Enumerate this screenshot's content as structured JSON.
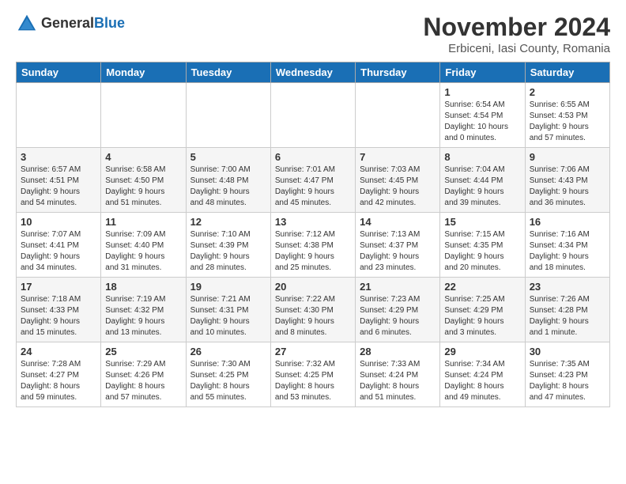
{
  "logo": {
    "general": "General",
    "blue": "Blue"
  },
  "title": "November 2024",
  "subtitle": "Erbiceni, Iasi County, Romania",
  "days_of_week": [
    "Sunday",
    "Monday",
    "Tuesday",
    "Wednesday",
    "Thursday",
    "Friday",
    "Saturday"
  ],
  "weeks": [
    [
      {
        "day": "",
        "info": ""
      },
      {
        "day": "",
        "info": ""
      },
      {
        "day": "",
        "info": ""
      },
      {
        "day": "",
        "info": ""
      },
      {
        "day": "",
        "info": ""
      },
      {
        "day": "1",
        "info": "Sunrise: 6:54 AM\nSunset: 4:54 PM\nDaylight: 10 hours\nand 0 minutes."
      },
      {
        "day": "2",
        "info": "Sunrise: 6:55 AM\nSunset: 4:53 PM\nDaylight: 9 hours\nand 57 minutes."
      }
    ],
    [
      {
        "day": "3",
        "info": "Sunrise: 6:57 AM\nSunset: 4:51 PM\nDaylight: 9 hours\nand 54 minutes."
      },
      {
        "day": "4",
        "info": "Sunrise: 6:58 AM\nSunset: 4:50 PM\nDaylight: 9 hours\nand 51 minutes."
      },
      {
        "day": "5",
        "info": "Sunrise: 7:00 AM\nSunset: 4:48 PM\nDaylight: 9 hours\nand 48 minutes."
      },
      {
        "day": "6",
        "info": "Sunrise: 7:01 AM\nSunset: 4:47 PM\nDaylight: 9 hours\nand 45 minutes."
      },
      {
        "day": "7",
        "info": "Sunrise: 7:03 AM\nSunset: 4:45 PM\nDaylight: 9 hours\nand 42 minutes."
      },
      {
        "day": "8",
        "info": "Sunrise: 7:04 AM\nSunset: 4:44 PM\nDaylight: 9 hours\nand 39 minutes."
      },
      {
        "day": "9",
        "info": "Sunrise: 7:06 AM\nSunset: 4:43 PM\nDaylight: 9 hours\nand 36 minutes."
      }
    ],
    [
      {
        "day": "10",
        "info": "Sunrise: 7:07 AM\nSunset: 4:41 PM\nDaylight: 9 hours\nand 34 minutes."
      },
      {
        "day": "11",
        "info": "Sunrise: 7:09 AM\nSunset: 4:40 PM\nDaylight: 9 hours\nand 31 minutes."
      },
      {
        "day": "12",
        "info": "Sunrise: 7:10 AM\nSunset: 4:39 PM\nDaylight: 9 hours\nand 28 minutes."
      },
      {
        "day": "13",
        "info": "Sunrise: 7:12 AM\nSunset: 4:38 PM\nDaylight: 9 hours\nand 25 minutes."
      },
      {
        "day": "14",
        "info": "Sunrise: 7:13 AM\nSunset: 4:37 PM\nDaylight: 9 hours\nand 23 minutes."
      },
      {
        "day": "15",
        "info": "Sunrise: 7:15 AM\nSunset: 4:35 PM\nDaylight: 9 hours\nand 20 minutes."
      },
      {
        "day": "16",
        "info": "Sunrise: 7:16 AM\nSunset: 4:34 PM\nDaylight: 9 hours\nand 18 minutes."
      }
    ],
    [
      {
        "day": "17",
        "info": "Sunrise: 7:18 AM\nSunset: 4:33 PM\nDaylight: 9 hours\nand 15 minutes."
      },
      {
        "day": "18",
        "info": "Sunrise: 7:19 AM\nSunset: 4:32 PM\nDaylight: 9 hours\nand 13 minutes."
      },
      {
        "day": "19",
        "info": "Sunrise: 7:21 AM\nSunset: 4:31 PM\nDaylight: 9 hours\nand 10 minutes."
      },
      {
        "day": "20",
        "info": "Sunrise: 7:22 AM\nSunset: 4:30 PM\nDaylight: 9 hours\nand 8 minutes."
      },
      {
        "day": "21",
        "info": "Sunrise: 7:23 AM\nSunset: 4:29 PM\nDaylight: 9 hours\nand 6 minutes."
      },
      {
        "day": "22",
        "info": "Sunrise: 7:25 AM\nSunset: 4:29 PM\nDaylight: 9 hours\nand 3 minutes."
      },
      {
        "day": "23",
        "info": "Sunrise: 7:26 AM\nSunset: 4:28 PM\nDaylight: 9 hours\nand 1 minute."
      }
    ],
    [
      {
        "day": "24",
        "info": "Sunrise: 7:28 AM\nSunset: 4:27 PM\nDaylight: 8 hours\nand 59 minutes."
      },
      {
        "day": "25",
        "info": "Sunrise: 7:29 AM\nSunset: 4:26 PM\nDaylight: 8 hours\nand 57 minutes."
      },
      {
        "day": "26",
        "info": "Sunrise: 7:30 AM\nSunset: 4:25 PM\nDaylight: 8 hours\nand 55 minutes."
      },
      {
        "day": "27",
        "info": "Sunrise: 7:32 AM\nSunset: 4:25 PM\nDaylight: 8 hours\nand 53 minutes."
      },
      {
        "day": "28",
        "info": "Sunrise: 7:33 AM\nSunset: 4:24 PM\nDaylight: 8 hours\nand 51 minutes."
      },
      {
        "day": "29",
        "info": "Sunrise: 7:34 AM\nSunset: 4:24 PM\nDaylight: 8 hours\nand 49 minutes."
      },
      {
        "day": "30",
        "info": "Sunrise: 7:35 AM\nSunset: 4:23 PM\nDaylight: 8 hours\nand 47 minutes."
      }
    ]
  ]
}
